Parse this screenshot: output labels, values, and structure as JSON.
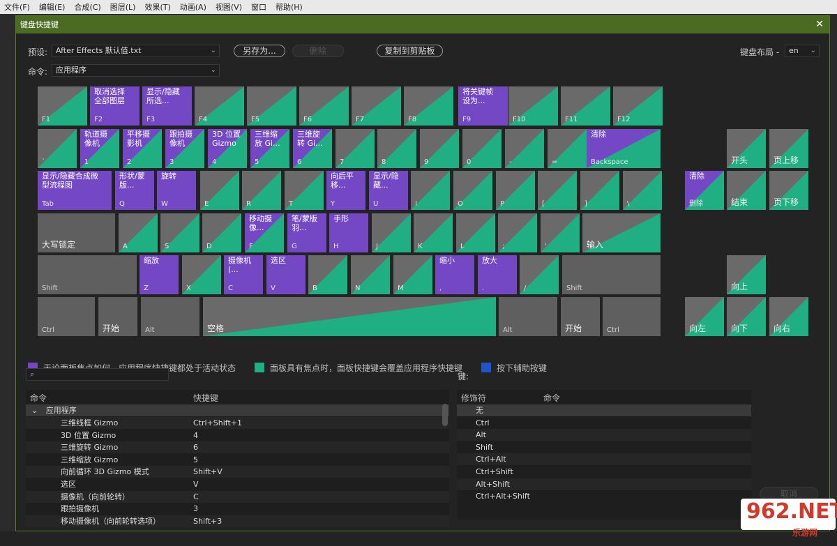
{
  "menubar": [
    "文件(F)",
    "编辑(E)",
    "合成(C)",
    "图层(L)",
    "效果(T)",
    "动画(A)",
    "视图(V)",
    "窗口",
    "帮助(H)"
  ],
  "dialog": {
    "title": "键盘快捷键",
    "close": "✕"
  },
  "toolbar": {
    "preset_label": "预设:",
    "preset_value": "After Effects 默认值.txt",
    "save_as": "另存为...",
    "delete": "删除",
    "copy_clipboard": "复制到剪贴板",
    "layout_label": "键盘布局 -",
    "layout_value": "en",
    "command_label": "命令:",
    "command_value": "应用程序"
  },
  "keys": [
    {
      "c": "",
      "l": "F1",
      "t": "d"
    },
    {
      "c": "取消选择\n全部图层",
      "l": "F2",
      "t": "p"
    },
    {
      "c": "显示/隐藏\n所选...",
      "l": "F3",
      "t": "p"
    },
    {
      "c": "",
      "l": "F4",
      "t": "d"
    },
    {
      "c": "",
      "l": "F5",
      "t": "d"
    },
    {
      "c": "",
      "l": "F6",
      "t": "d"
    },
    {
      "c": "",
      "l": "F7",
      "t": "d"
    },
    {
      "c": "",
      "l": "F8",
      "t": "d"
    },
    {
      "c": "将关键帧\n设为...",
      "l": "F9",
      "t": "p"
    },
    {
      "c": "",
      "l": "F10",
      "t": "d"
    },
    {
      "c": "",
      "l": "F11",
      "t": "d"
    },
    {
      "c": "",
      "l": "F12",
      "t": "d"
    },
    {
      "c": "",
      "l": "`",
      "t": "d"
    },
    {
      "c": "轨道摄\n像机",
      "l": "1",
      "t": "pg"
    },
    {
      "c": "平移摄\n影机",
      "l": "2",
      "t": "pg"
    },
    {
      "c": "跟拍摄\n像机",
      "l": "3",
      "t": "pg"
    },
    {
      "c": "3D 位置\nGizmo",
      "l": "4",
      "t": "pg"
    },
    {
      "c": "三维缩\n放 Gi...",
      "l": "5",
      "t": "pg"
    },
    {
      "c": "三维旋\n转 Gi...",
      "l": "6",
      "t": "pg"
    },
    {
      "c": "",
      "l": "7",
      "t": "d"
    },
    {
      "c": "",
      "l": "8",
      "t": "d"
    },
    {
      "c": "",
      "l": "9",
      "t": "d"
    },
    {
      "c": "",
      "l": "0",
      "t": "d"
    },
    {
      "c": "",
      "l": "-",
      "t": "d"
    },
    {
      "c": "",
      "l": "=",
      "t": "d"
    },
    {
      "c": "清除",
      "l": "Backspace",
      "t": "pg"
    },
    {
      "c": "显示/隐藏合成微\n型流程图",
      "l": "Tab",
      "t": "p"
    },
    {
      "c": "形状/蒙\n版...",
      "l": "Q",
      "t": "p"
    },
    {
      "c": "旋转",
      "l": "W",
      "t": "p"
    },
    {
      "c": "",
      "l": "E",
      "t": "d"
    },
    {
      "c": "",
      "l": "R",
      "t": "d"
    },
    {
      "c": "",
      "l": "T",
      "t": "d"
    },
    {
      "c": "向后平\n移...",
      "l": "Y",
      "t": "p"
    },
    {
      "c": "显示/隐\n藏...",
      "l": "U",
      "t": "p"
    },
    {
      "c": "",
      "l": "I",
      "t": "d"
    },
    {
      "c": "",
      "l": "O",
      "t": "d"
    },
    {
      "c": "",
      "l": "P",
      "t": "d"
    },
    {
      "c": "",
      "l": "[",
      "t": "d"
    },
    {
      "c": "",
      "l": "]",
      "t": "d"
    },
    {
      "c": "",
      "l": "\\",
      "t": "d"
    },
    {
      "c": "",
      "l": "大写锁定",
      "t": "g"
    },
    {
      "c": "",
      "l": "A",
      "t": "d"
    },
    {
      "c": "",
      "l": "S",
      "t": "d"
    },
    {
      "c": "",
      "l": "D",
      "t": "d"
    },
    {
      "c": "移动摄\n像...",
      "l": "F",
      "t": "pg"
    },
    {
      "c": "笔/蒙版\n羽...",
      "l": "G",
      "t": "p"
    },
    {
      "c": "手形",
      "l": "H",
      "t": "p"
    },
    {
      "c": "",
      "l": "J",
      "t": "d"
    },
    {
      "c": "",
      "l": "K",
      "t": "d"
    },
    {
      "c": "",
      "l": "L",
      "t": "d"
    },
    {
      "c": "",
      "l": ";",
      "t": "d"
    },
    {
      "c": "",
      "l": "'",
      "t": "d"
    },
    {
      "c": "",
      "l": "输入",
      "t": "d"
    },
    {
      "c": "",
      "l": "Shift",
      "t": "g"
    },
    {
      "c": "缩放",
      "l": "Z",
      "t": "p"
    },
    {
      "c": "",
      "l": "X",
      "t": "d"
    },
    {
      "c": "摄像机\n(...",
      "l": "C",
      "t": "p"
    },
    {
      "c": "选区",
      "l": "V",
      "t": "p"
    },
    {
      "c": "",
      "l": "B",
      "t": "d"
    },
    {
      "c": "",
      "l": "N",
      "t": "d"
    },
    {
      "c": "",
      "l": "M",
      "t": "d"
    },
    {
      "c": "缩小",
      "l": ",",
      "t": "p"
    },
    {
      "c": "放大",
      "l": ".",
      "t": "p"
    },
    {
      "c": "",
      "l": "/",
      "t": "d"
    },
    {
      "c": "",
      "l": "Shift",
      "t": "g"
    },
    {
      "c": "",
      "l": "Ctrl",
      "t": "g"
    },
    {
      "c": "",
      "l": "开始",
      "t": "g"
    },
    {
      "c": "",
      "l": "Alt",
      "t": "g"
    },
    {
      "c": "",
      "l": "空格",
      "t": "d"
    },
    {
      "c": "",
      "l": "Alt",
      "t": "g"
    },
    {
      "c": "",
      "l": "开始",
      "t": "g"
    },
    {
      "c": "",
      "l": "Ctrl",
      "t": "g"
    },
    {
      "c": "",
      "l": "开头",
      "t": "d"
    },
    {
      "c": "",
      "l": "页上移",
      "t": "d"
    },
    {
      "c": "清除",
      "l": "删除",
      "t": "pg"
    },
    {
      "c": "",
      "l": "结束",
      "t": "d"
    },
    {
      "c": "",
      "l": "页下移",
      "t": "d"
    },
    {
      "c": "",
      "l": "向上",
      "t": "d"
    },
    {
      "c": "",
      "l": "向左",
      "t": "d"
    },
    {
      "c": "",
      "l": "向下",
      "t": "d"
    },
    {
      "c": "",
      "l": "向右",
      "t": "d"
    }
  ],
  "legend": [
    "无论面板焦点如何，应用程序快捷键都处于活动状态",
    "面板具有焦点时，面板快捷键会覆盖应用程序快捷键",
    "按下辅助按键"
  ],
  "legend_colors": {
    "purple": "#7447c4",
    "green": "#1faf83",
    "blue": "#1f55c8"
  },
  "search": {
    "placeholder": ""
  },
  "left_table": {
    "headers": [
      "命令",
      "快捷键"
    ],
    "group": "应用程序",
    "rows": [
      [
        "三维线框 Gizmo",
        "Ctrl+Shift+1"
      ],
      [
        "3D 位置 Gizmo",
        "4"
      ],
      [
        "三维旋转 Gizmo",
        "6"
      ],
      [
        "三维缩放 Gizmo",
        "5"
      ],
      [
        "向前循环 3D Gizmo 模式",
        "Shift+V"
      ],
      [
        "选区",
        "V"
      ],
      [
        "摄像机（向前轮转）",
        "C"
      ],
      [
        "跟拍摄像机",
        "3"
      ],
      [
        "移动摄像机（向前轮转选项）",
        "Shift+3"
      ]
    ]
  },
  "key_label": "键:",
  "right_table": {
    "headers": [
      "修饰符",
      "命令"
    ],
    "rows": [
      "无",
      "Ctrl",
      "Alt",
      "Shift",
      "Ctrl+Alt",
      "Ctrl+Shift",
      "Alt+Shift",
      "Ctrl+Alt+Shift"
    ]
  },
  "cancel": "取消",
  "watermark": {
    "main": "962.NET",
    "sub": "乐游网"
  }
}
